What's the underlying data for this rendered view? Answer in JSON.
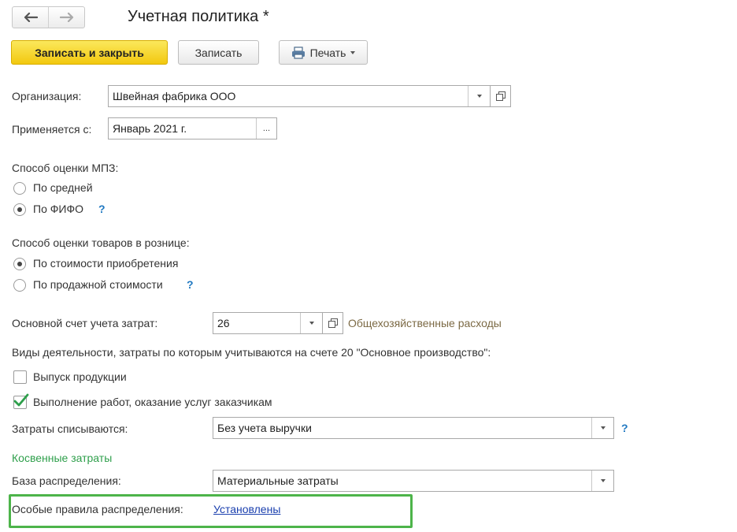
{
  "window": {
    "title": "Учетная политика *",
    "nav": {
      "back": "←",
      "forward": "→"
    }
  },
  "toolbar": {
    "save_close_label": "Записать и закрыть",
    "save_label": "Записать",
    "print_label": "Печать",
    "print_icon": "printer-icon"
  },
  "organization": {
    "label": "Организация:",
    "value": "Швейная фабрика ООО"
  },
  "applies_from": {
    "label": "Применяется с:",
    "value": "Январь 2021 г.",
    "picker": "..."
  },
  "mpz_valuation": {
    "label": "Способ оценки МПЗ:",
    "options": [
      {
        "label": "По средней",
        "selected": false
      },
      {
        "label": "По ФИФО",
        "selected": true
      }
    ],
    "help": "?"
  },
  "retail_valuation": {
    "label": "Способ оценки товаров в рознице:",
    "options": [
      {
        "label": "По стоимости приобретения",
        "selected": true
      },
      {
        "label": "По продажной стоимости",
        "selected": false
      }
    ],
    "help": "?"
  },
  "cost_account": {
    "label": "Основной счет учета затрат:",
    "value": "26",
    "description": "Общехозяйственные расходы"
  },
  "activities": {
    "label": "Виды деятельности, затраты по которым учитываются на счете 20 \"Основное производство\":",
    "items": [
      {
        "label": "Выпуск продукции",
        "checked": false
      },
      {
        "label": "Выполнение работ, оказание услуг заказчикам",
        "checked": true
      }
    ]
  },
  "write_off": {
    "label": "Затраты списываются:",
    "value": "Без учета выручки",
    "help": "?"
  },
  "indirect_costs": {
    "section_title": "Косвенные затраты",
    "base_label": "База распределения:",
    "base_value": "Материальные затраты",
    "rules_label": "Особые правила распределения:",
    "rules_link": "Установлены"
  },
  "colors": {
    "primary_button": "#f5cf1a",
    "section_title": "#2e9f4b",
    "help": "#1f78c1",
    "link": "#1a3fae",
    "highlight_border": "#4db44a"
  }
}
